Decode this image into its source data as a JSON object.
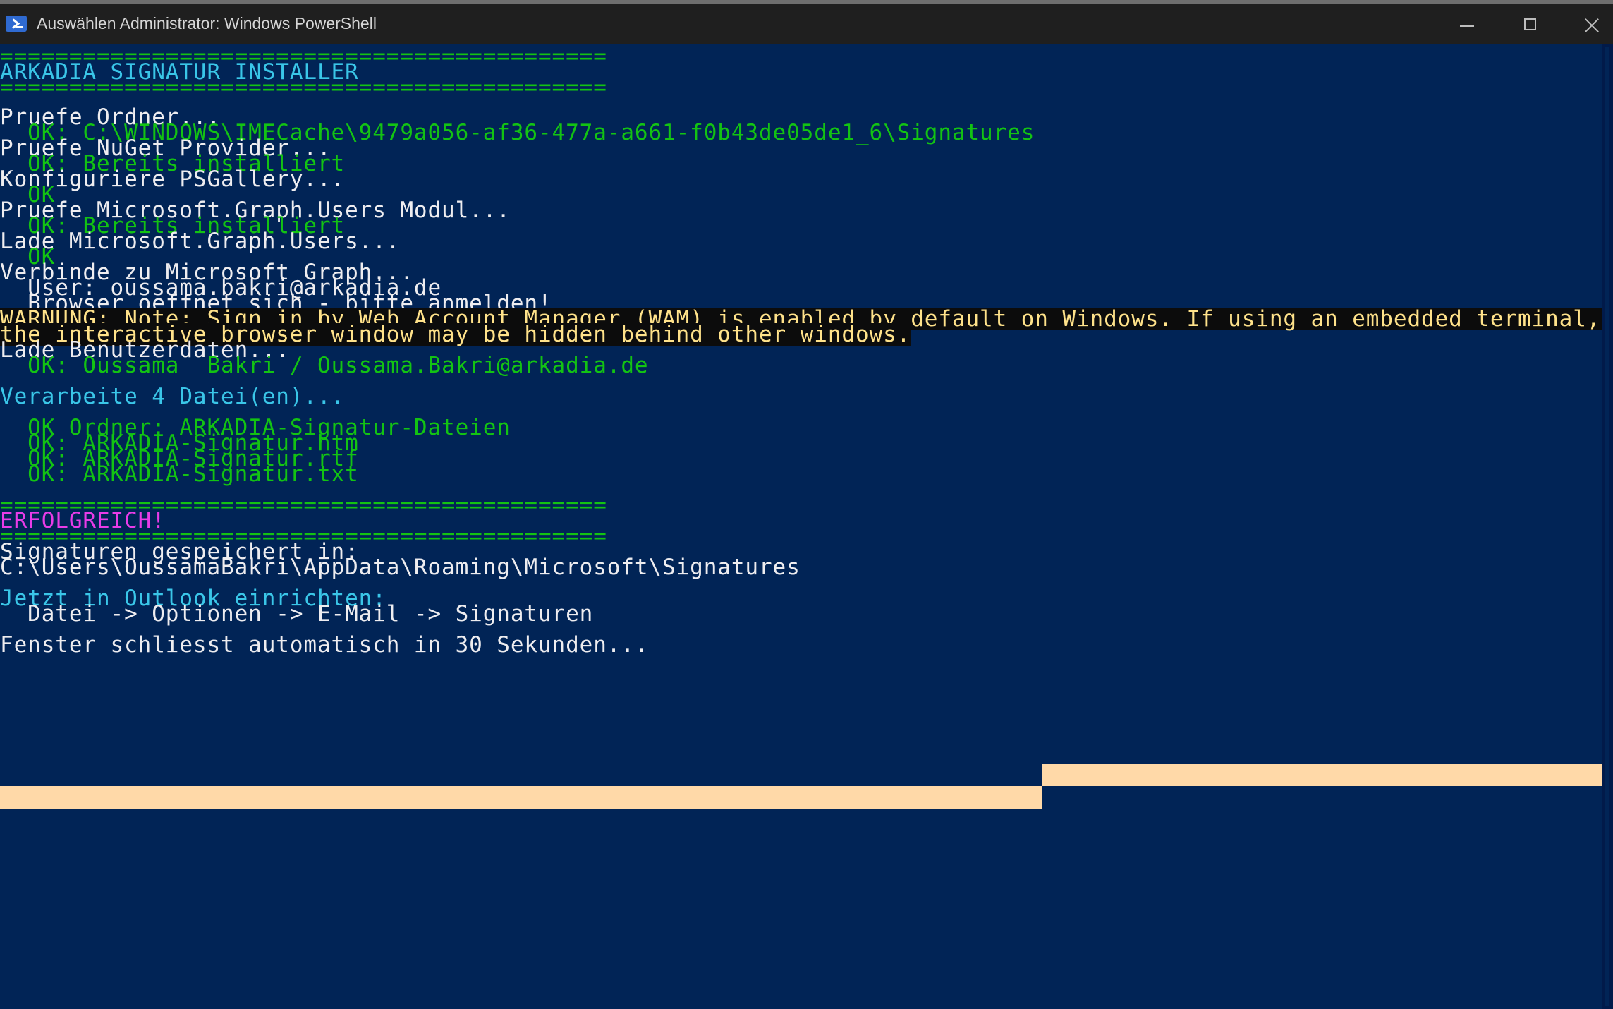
{
  "window": {
    "title": "Auswählen Administrator: Windows PowerShell",
    "icon": "powershell-icon",
    "controls": [
      "minimize-icon",
      "maximize-icon",
      "close-icon"
    ]
  },
  "colors": {
    "background": "#012456",
    "titlebar": "#1F1F1F",
    "default_text": "#EEEDF0",
    "success_text": "#13C313",
    "header_text": "#3AC6E8",
    "warning_text": "#FFE28A",
    "warning_background": "#0C0C0C",
    "selection": "#FFD9A8"
  },
  "console": {
    "lines": [
      "============================================",
      "ARKADIA SIGNATUR INSTALLER",
      "============================================",
      "Pruefe Ordner...",
      "  OK: C:\\WINDOWS\\IMECache\\9479a056-af36-477a-a661-f0b43de05de1_6\\Signatures",
      "Pruefe NuGet Provider...",
      "  OK: Bereits installiert",
      "Konfiguriere PSGallery...",
      "  OK",
      "Pruefe Microsoft.Graph.Users Modul...",
      "  OK: Bereits installiert",
      "Lade Microsoft.Graph.Users...",
      "  OK",
      "Verbinde zu Microsoft Graph...",
      "  User: oussama.bakri@arkadia.de",
      "  Browser oeffnet sich - bitte anmelden!",
      "WARNUNG: Note: Sign in by Web Account Manager (WAM) is enabled by default on Windows. If using an embedded terminal, ",
      "the interactive browser window may be hidden behind other windows.",
      "Lade Benutzerdaten...",
      "  OK: Oussama  Bakri / Oussama.Bakri@arkadia.de",
      "Verarbeite 4 Datei(en)...",
      "  OK Ordner: ARKADIA-Signatur-Dateien",
      "  OK: ARKADIA-Signatur.htm",
      "  OK: ARKADIA-Signatur.rtf",
      "  OK: ARKADIA-Signatur.txt",
      "============================================",
      "ERFOLGREICH!",
      "============================================",
      "Signaturen gespeichert in:",
      "C:\\Users\\OussamaBakri\\AppData\\Roaming\\Microsoft\\Signatures",
      "Jetzt in Outlook einrichten:",
      "  Datei -> Optionen -> E-Mail -> Signaturen",
      "Fenster schliesst automatisch in 30 Sekunden..."
    ]
  }
}
